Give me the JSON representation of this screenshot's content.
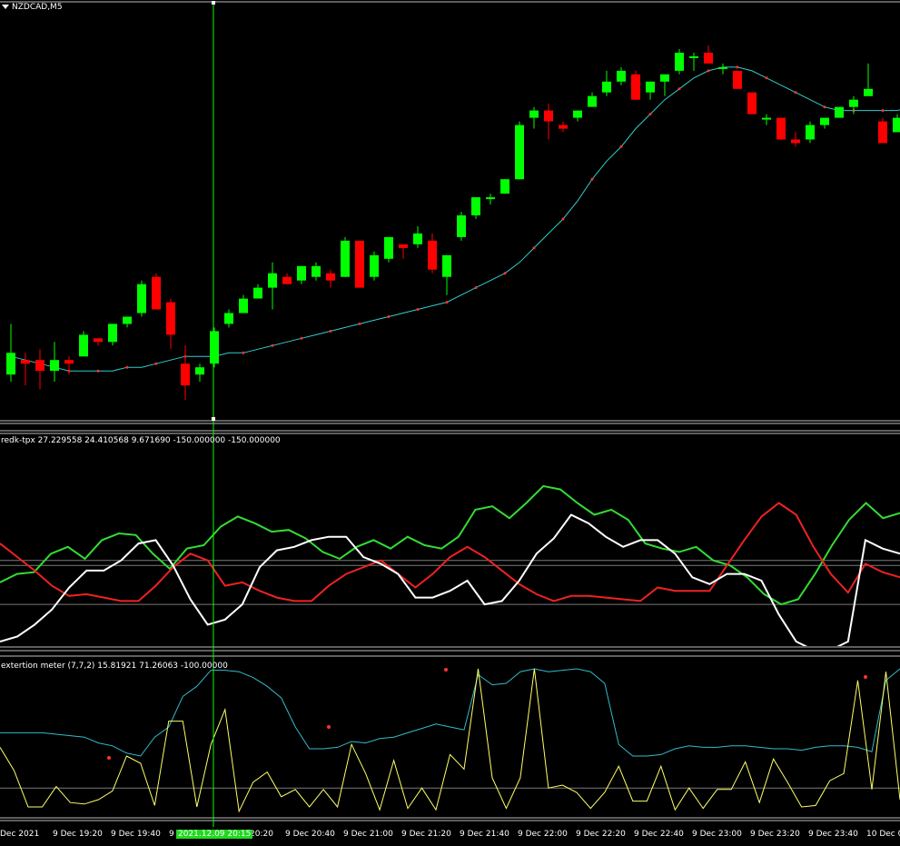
{
  "window": {
    "symbol_label": "NZDCAD,M5",
    "dropdown_icon": "triangle-down-icon"
  },
  "colors": {
    "background": "#000000",
    "bull": "#00ff00",
    "bear": "#ff0000",
    "ma": "#33cccc",
    "ma_marker": "#ff3333",
    "grid": "#7a7a7a",
    "crosshair": "#00ff00",
    "tpx_green": "#33dd33",
    "tpx_red": "#ee2222",
    "tpx_white": "#ffffff",
    "ext_cyan": "#33bbcc",
    "ext_yellow": "#ffff66"
  },
  "indicators": {
    "tpx_label": "redk-tpx 27.229558 24.410568 9.671690 -150.000000 -150.000000",
    "extension_label": "extertion meter (7,7,2) 15.81921 71.26063 -100.00000"
  },
  "time_axis": {
    "ticks": [
      "Dec 2021",
      "9 Dec 19:20",
      "9 Dec 19:40",
      "9",
      "20:20",
      "9 Dec 20:40",
      "9 Dec 21:00",
      "9 Dec 21:20",
      "9 Dec 21:40",
      "9 Dec 22:00",
      "9 Dec 22:20",
      "9 Dec 22:40",
      "9 Dec 23:00",
      "9 Dec 23:20",
      "9 Dec 23:40",
      "10 Dec 0"
    ],
    "crosshair_label": "2021.12.09 20:15"
  },
  "chart_data": [
    {
      "type": "candlestick",
      "title": "NZDCAD,M5",
      "ylim": [
        0,
        100
      ],
      "candles": [
        {
          "o": 15,
          "c": 21,
          "h": 29,
          "l": 13
        },
        {
          "o": 19,
          "c": 18,
          "h": 21,
          "l": 12
        },
        {
          "o": 19,
          "c": 16,
          "h": 22,
          "l": 11
        },
        {
          "o": 16,
          "c": 19,
          "h": 24,
          "l": 13
        },
        {
          "o": 19,
          "c": 18,
          "h": 20,
          "l": 15
        },
        {
          "o": 20,
          "c": 26,
          "h": 27,
          "l": 20
        },
        {
          "o": 25,
          "c": 24,
          "h": 25,
          "l": 23
        },
        {
          "o": 24,
          "c": 29,
          "h": 29,
          "l": 23
        },
        {
          "o": 29,
          "c": 31,
          "h": 31,
          "l": 28
        },
        {
          "o": 32,
          "c": 40,
          "h": 41,
          "l": 31
        },
        {
          "o": 42,
          "c": 33,
          "h": 43,
          "l": 33
        },
        {
          "o": 35,
          "c": 26,
          "h": 36,
          "l": 22
        },
        {
          "o": 18,
          "c": 12,
          "h": 23,
          "l": 8
        },
        {
          "o": 15,
          "c": 17,
          "h": 18,
          "l": 13
        },
        {
          "o": 18,
          "c": 27,
          "h": 28,
          "l": 17
        },
        {
          "o": 29,
          "c": 32,
          "h": 33,
          "l": 28
        },
        {
          "o": 32,
          "c": 36,
          "h": 37,
          "l": 32
        },
        {
          "o": 36,
          "c": 39,
          "h": 40,
          "l": 36
        },
        {
          "o": 39,
          "c": 43,
          "h": 46,
          "l": 33
        },
        {
          "o": 42,
          "c": 40,
          "h": 43,
          "l": 40
        },
        {
          "o": 41,
          "c": 45,
          "h": 45,
          "l": 40
        },
        {
          "o": 42,
          "c": 45,
          "h": 46,
          "l": 41
        },
        {
          "o": 43,
          "c": 41,
          "h": 44,
          "l": 39
        },
        {
          "o": 42,
          "c": 52,
          "h": 53,
          "l": 42
        },
        {
          "o": 52,
          "c": 39,
          "h": 52,
          "l": 39
        },
        {
          "o": 42,
          "c": 48,
          "h": 49,
          "l": 41
        },
        {
          "o": 47,
          "c": 53,
          "h": 53,
          "l": 46
        },
        {
          "o": 51,
          "c": 50,
          "h": 51,
          "l": 47
        },
        {
          "o": 51,
          "c": 54,
          "h": 56,
          "l": 50
        },
        {
          "o": 52,
          "c": 44,
          "h": 54,
          "l": 43
        },
        {
          "o": 42,
          "c": 48,
          "h": 48,
          "l": 37
        },
        {
          "o": 53,
          "c": 59,
          "h": 60,
          "l": 52
        },
        {
          "o": 59,
          "c": 64,
          "h": 64,
          "l": 58
        },
        {
          "o": 64,
          "c": 64,
          "h": 65,
          "l": 62
        },
        {
          "o": 65,
          "c": 69,
          "h": 69,
          "l": 65
        },
        {
          "o": 69,
          "c": 84,
          "h": 85,
          "l": 69
        },
        {
          "o": 86,
          "c": 88,
          "h": 89,
          "l": 83
        },
        {
          "o": 88,
          "c": 85,
          "h": 90,
          "l": 80
        },
        {
          "o": 84,
          "c": 83,
          "h": 85,
          "l": 82
        },
        {
          "o": 86,
          "c": 88,
          "h": 88,
          "l": 85
        },
        {
          "o": 89,
          "c": 92,
          "h": 93,
          "l": 89
        },
        {
          "o": 93,
          "c": 96,
          "h": 99,
          "l": 92
        },
        {
          "o": 96,
          "c": 99,
          "h": 100,
          "l": 95
        },
        {
          "o": 98,
          "c": 91,
          "h": 99,
          "l": 91
        },
        {
          "o": 93,
          "c": 96,
          "h": 96,
          "l": 91
        },
        {
          "o": 96,
          "c": 98,
          "h": 98,
          "l": 92
        },
        {
          "o": 99,
          "c": 104,
          "h": 105,
          "l": 98
        },
        {
          "o": 103,
          "c": 103,
          "h": 104,
          "l": 99
        },
        {
          "o": 104,
          "c": 101,
          "h": 106,
          "l": 101
        },
        {
          "o": 100,
          "c": 100,
          "h": 101,
          "l": 98
        },
        {
          "o": 99,
          "c": 94,
          "h": 99,
          "l": 94
        },
        {
          "o": 93,
          "c": 87,
          "h": 93,
          "l": 87
        },
        {
          "o": 86,
          "c": 86,
          "h": 87,
          "l": 84
        },
        {
          "o": 86,
          "c": 80,
          "h": 86,
          "l": 80
        },
        {
          "o": 80,
          "c": 79,
          "h": 82,
          "l": 78
        },
        {
          "o": 80,
          "c": 84,
          "h": 85,
          "l": 79
        },
        {
          "o": 84,
          "c": 86,
          "h": 86,
          "l": 83
        },
        {
          "o": 86,
          "c": 89,
          "h": 89,
          "l": 86
        },
        {
          "o": 89,
          "c": 91,
          "h": 92,
          "l": 87
        },
        {
          "o": 92,
          "c": 94,
          "h": 101,
          "l": 92
        },
        {
          "o": 85,
          "c": 79,
          "h": 86,
          "l": 79
        },
        {
          "o": 82,
          "c": 86,
          "h": 87,
          "l": 82
        },
        {
          "o": 86,
          "c": 90,
          "h": 96,
          "l": 86
        }
      ],
      "ma": [
        20,
        19,
        18,
        17,
        16,
        16,
        16,
        16,
        17,
        17,
        18,
        19,
        20,
        20,
        20,
        21,
        21,
        22,
        23,
        24,
        25,
        26,
        27,
        28,
        29,
        30,
        31,
        32,
        33,
        34,
        35,
        37,
        39,
        41,
        43,
        46,
        50,
        54,
        58,
        63,
        69,
        74,
        78,
        83,
        87,
        91,
        94,
        97,
        99,
        100,
        100,
        99,
        97,
        95,
        93,
        91,
        89,
        88,
        88,
        88,
        88,
        88,
        89
      ]
    },
    {
      "type": "line",
      "title": "redk-tpx 27.229558 24.410568 9.671690 -150.000000 -150.000000",
      "ylim": [
        0,
        100
      ],
      "hlines": [
        48,
        45,
        22
      ],
      "series": [
        {
          "color": "#33dd33",
          "values": [
            35,
            40,
            41,
            52,
            56,
            49,
            60,
            64,
            63,
            52,
            43,
            55,
            57,
            68,
            74,
            70,
            65,
            66,
            61,
            53,
            49,
            56,
            60,
            55,
            62,
            57,
            55,
            62,
            78,
            80,
            73,
            82,
            92,
            90,
            82,
            75,
            78,
            72,
            58,
            55,
            53,
            56,
            48,
            45,
            38,
            28,
            22,
            25,
            40,
            57,
            72,
            82,
            73,
            76
          ]
        },
        {
          "color": "#ee2222",
          "values": [
            58,
            50,
            42,
            33,
            27,
            28,
            26,
            24,
            24,
            33,
            44,
            52,
            48,
            33,
            35,
            30,
            26,
            24,
            24,
            33,
            40,
            44,
            48,
            40,
            32,
            40,
            50,
            56,
            50,
            42,
            34,
            28,
            24,
            27,
            27,
            26,
            25,
            24,
            32,
            30,
            30,
            30,
            45,
            60,
            74,
            82,
            75,
            56,
            40,
            29,
            46,
            41,
            38
          ]
        },
        {
          "color": "#ffffff",
          "values": [
            0,
            3,
            10,
            19,
            32,
            42,
            42,
            48,
            58,
            60,
            45,
            25,
            10,
            13,
            22,
            44,
            54,
            56,
            60,
            62,
            62,
            50,
            46,
            40,
            26,
            26,
            30,
            36,
            22,
            24,
            36,
            52,
            61,
            75,
            70,
            62,
            56,
            60,
            60,
            52,
            38,
            34,
            40,
            40,
            36,
            16,
            0,
            -5,
            -5,
            0,
            60,
            55,
            52
          ]
        }
      ]
    },
    {
      "type": "line",
      "title": "extertion meter (7,7,2) 15.81921 71.26063 -100.00000",
      "ylim": [
        0,
        100
      ],
      "hlines": [
        18
      ],
      "series": [
        {
          "color": "#33bbcc",
          "values": [
            56,
            56,
            56,
            56,
            55,
            54,
            53,
            49,
            47,
            42,
            40,
            53,
            60,
            81,
            88,
            99,
            99,
            98,
            94,
            88,
            80,
            60,
            45,
            45,
            46,
            50,
            49,
            52,
            53,
            56,
            59,
            62,
            60,
            58,
            96,
            89,
            90,
            98,
            100,
            98,
            99,
            100,
            98,
            90,
            48,
            40,
            40,
            41,
            45,
            47,
            46,
            46,
            47,
            47,
            46,
            45,
            45,
            44,
            46,
            47,
            47,
            46,
            43,
            92,
            100
          ]
        },
        {
          "color": "#ffff66",
          "values": [
            46,
            30,
            5,
            5,
            19,
            8,
            7,
            10,
            16,
            40,
            35,
            6,
            64,
            64,
            5,
            48,
            72,
            2,
            22,
            29,
            12,
            17,
            5,
            17,
            5,
            48,
            28,
            3,
            37,
            4,
            18,
            3,
            41,
            31,
            100,
            25,
            4,
            25,
            100,
            18,
            20,
            15,
            4,
            15,
            33,
            9,
            9,
            33,
            3,
            18,
            4,
            17,
            17,
            36,
            8,
            38,
            22,
            5,
            6,
            23,
            28,
            92,
            17,
            98,
            10
          ]
        }
      ]
    }
  ]
}
